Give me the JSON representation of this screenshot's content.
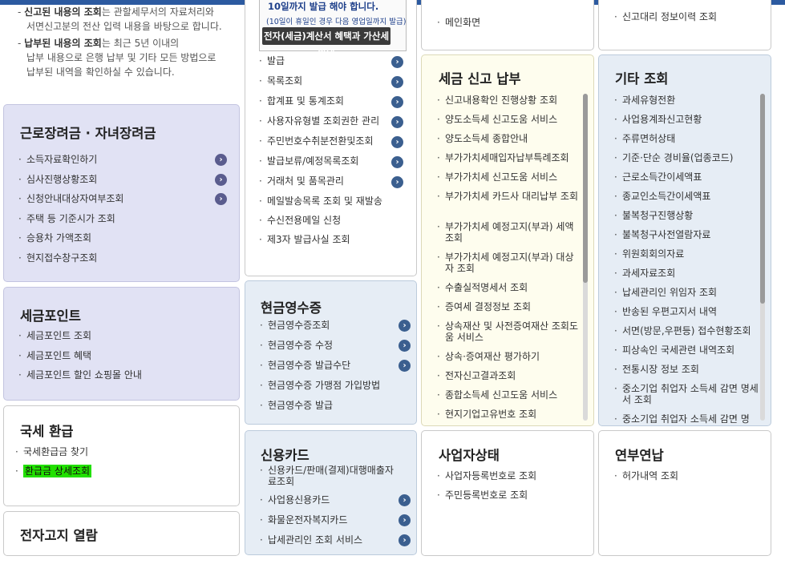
{
  "notes": [
    {
      "bold": "신고된 내용의 조회",
      "rest": "는 관할세무서의 자료처리와",
      "line2": "서면신고분의 전산 입력 내용을 바탕으로 합니다."
    },
    {
      "bold": "납부된 내용의 조회",
      "rest": "는 최근 5년 이내의",
      "line2": "납부 내용으로 은행 납부 및 기타 모든 방법으로",
      "line3": "납부된 내역을 확인하실 수 있습니다."
    }
  ],
  "etax_notice": {
    "line1": "10일까지 발급 해야 합니다.",
    "line2": "(10일이 휴일인 경우 다음 영업일까지 발급)",
    "banner": "전자(세금)계산서 혜택과 가산세 안내"
  },
  "etax_items": [
    "발급",
    "목록조회",
    "합계표 및 통계조회",
    "사용자유형별 조회권한 관리",
    "주민번호수취분전환및조회",
    "발급보류/예정목록조회",
    "거래처 및 품목관리",
    "메일발송목록 조회 및 재발송",
    "수신전용메일 신청",
    "제3자 발급사실 조회"
  ],
  "main_menu": {
    "item": "메인화면"
  },
  "agency": {
    "item": "신고대리 정보이력 조회"
  },
  "earned_income": {
    "title": "근로장려금 · 자녀장려금",
    "items": [
      "소득자료확인하기",
      "심사진행상황조회",
      "신청안내대상자여부조회",
      "주택 등 기준시가 조회",
      "승용차 가액조회",
      "현지접수창구조회"
    ]
  },
  "tax_point": {
    "title": "세금포인트",
    "items": [
      "세금포인트 조회",
      "세금포인트 혜택",
      "세금포인트 할인 쇼핑몰 안내"
    ]
  },
  "refund": {
    "title": "국세 환급",
    "items": [
      "국세환급금 찾기",
      "환급금 상세조회"
    ]
  },
  "e_notice": {
    "title": "전자고지 열람"
  },
  "cash_receipt": {
    "title": "현금영수증",
    "items": [
      "현금영수증조회",
      "현금영수증 수정",
      "현금영수증 발급수단",
      "현금영수증 가맹점 가입방법",
      "현금영수증 발급"
    ]
  },
  "credit_card": {
    "title": "신용카드",
    "items": [
      "신용카드/판매(결제)대행매출자료조회",
      "사업용신용카드",
      "화물운전자복지카드",
      "납세관리인 조회 서비스"
    ]
  },
  "tax_filing": {
    "title": "세금 신고 납부",
    "items": [
      "신고내용확인 진행상황 조회",
      "양도소득세 신고도움 서비스",
      "양도소득세 종합안내",
      "부가가치세매입자납부특례조회",
      "부가가치세 신고도움 서비스",
      "부가가치세 카드사 대리납부 조회",
      "부가가치세 예정고지(부과) 세액조회",
      "부가가치세 예정고지(부과) 대상자 조회",
      "수출실적명세서 조회",
      "증여세 결정정보 조회",
      "상속재산 및 사전증여재산 조회도움 서비스",
      "상속·증여재산 평가하기",
      "전자신고결과조회",
      "종합소득세 신고도움 서비스",
      "현지기업고유번호 조회"
    ]
  },
  "business_status": {
    "title": "사업자상태",
    "items": [
      "사업자등록번호로 조회",
      "주민등록번호로 조회"
    ]
  },
  "other": {
    "title": "기타 조회",
    "items": [
      "과세유형전환",
      "사업용계좌신고현황",
      "주류면허상태",
      "기준·단순 경비율(업종코드)",
      "근로소득간이세액표",
      "종교인소득간이세액표",
      "불복청구진행상황",
      "불복청구사전열람자료",
      "위원회회의자료",
      "과세자료조회",
      "납세관리인 위임자 조회",
      "반송된 우편고지서 내역",
      "서면(방문,우편등) 접수현황조회",
      "피상속인 국세관련 내역조회",
      "전통시장 정보 조회",
      "중소기업 취업자 소득세 감면 명세서 조회",
      "중소기업 취업자 소득세 감면 명"
    ]
  },
  "year_end": {
    "title": "연부연납",
    "items": [
      "허가내역 조회"
    ]
  },
  "colors": {
    "lavender": "#e1e2f4",
    "blue": "#e6edf5",
    "cream": "#fefdee",
    "highlight": "#22e000",
    "arrow": "#3b5f8f"
  },
  "icons": {
    "arrow": "chevron-right-icon"
  }
}
